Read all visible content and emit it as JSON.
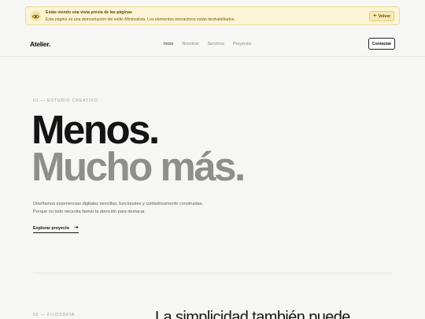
{
  "banner": {
    "title": "Estás viendo una vista previa de las páginas",
    "text": "Esta página es una demostración del estilo Minimalista. Los elementos interactivos están deshabilitados.",
    "back_label": "Volver",
    "icon": "eye-icon"
  },
  "nav": {
    "logo": "Atelier.",
    "links": [
      {
        "label": "Inicio",
        "active": true
      },
      {
        "label": "Nosotros",
        "active": false
      },
      {
        "label": "Servicios",
        "active": false
      },
      {
        "label": "Proyectos",
        "active": false
      }
    ],
    "contact_label": "Contactar"
  },
  "hero": {
    "eyebrow": "01 — ESTUDIO CREATIVO",
    "headline_1": "Menos.",
    "headline_2": "Mucho más.",
    "lede": "Diseñamos experiencias digitales sencillas, funcionales y cuidadosamente construidas. Porque no todo necesita llamar la atención para destacar.",
    "cta_label": "Explorar proyecto"
  },
  "philosophy": {
    "eyebrow": "02 — FILOSOFÍA",
    "heading": "La simplicidad también puede"
  },
  "colors": {
    "background": "#f6f6f5",
    "banner_bg": "#fbf4d6",
    "text": "#161616",
    "muted_headline": "#8e8e8c"
  }
}
